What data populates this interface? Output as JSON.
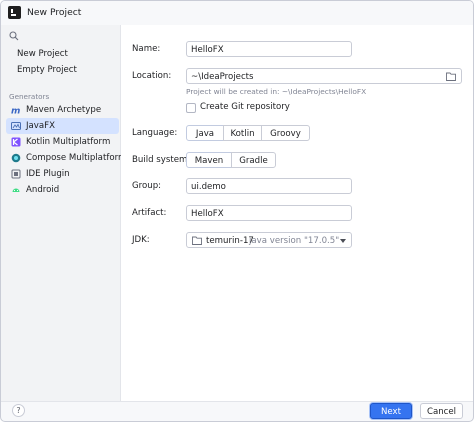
{
  "window": {
    "title": "New Project"
  },
  "sidebar": {
    "search_placeholder": "",
    "top_items": [
      {
        "label": "New Project"
      },
      {
        "label": "Empty Project"
      }
    ],
    "generators_label": "Generators",
    "generators": [
      {
        "label": "Maven Archetype",
        "icon": "maven-icon"
      },
      {
        "label": "JavaFX",
        "icon": "javafx-icon",
        "selected": true
      },
      {
        "label": "Kotlin Multiplatform",
        "icon": "kotlin-icon"
      },
      {
        "label": "Compose Multiplatform",
        "icon": "compose-icon"
      },
      {
        "label": "IDE Plugin",
        "icon": "plugin-icon"
      },
      {
        "label": "Android",
        "icon": "android-icon"
      }
    ]
  },
  "form": {
    "name_label": "Name:",
    "name_value": "HelloFX",
    "location_label": "Location:",
    "location_value": "~\\IdeaProjects",
    "location_hint": "Project will be created in: ~\\IdeaProjects\\HelloFX",
    "git_label": "Create Git repository",
    "git_checked": false,
    "language_label": "Language:",
    "language_options": [
      "Java",
      "Kotlin",
      "Groovy"
    ],
    "language_selected": "Java",
    "build_label": "Build system:",
    "build_options": [
      "Maven",
      "Gradle"
    ],
    "build_selected": "Maven",
    "group_label": "Group:",
    "group_value": "ui.demo",
    "artifact_label": "Artifact:",
    "artifact_value": "HelloFX",
    "jdk_label": "JDK:",
    "jdk_name": "temurin-17",
    "jdk_version": "java version \"17.0.5\""
  },
  "footer": {
    "help_label": "?",
    "next_label": "Next",
    "cancel_label": "Cancel"
  },
  "colors": {
    "accent": "#3574f0",
    "selection": "#d4e2ff",
    "hint_text": "#818594"
  }
}
